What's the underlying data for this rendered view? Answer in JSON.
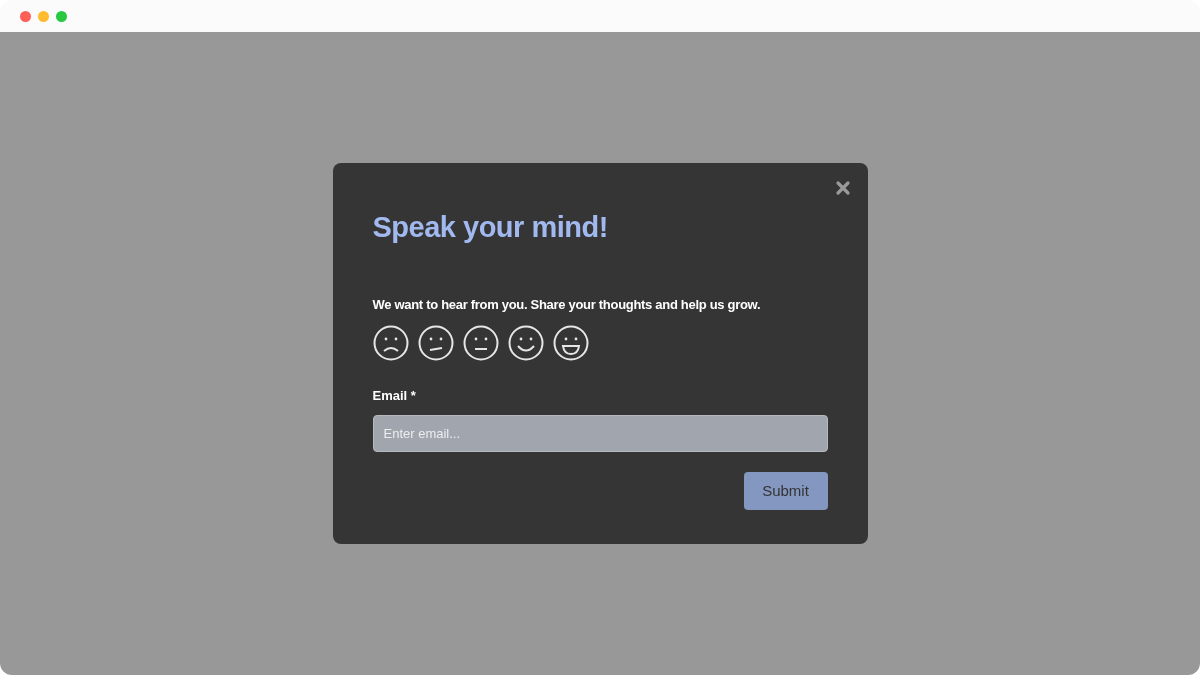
{
  "dialog": {
    "title": "Speak your mind!",
    "prompt": "We want to hear from you. Share your thoughts and help us grow.",
    "ratings": [
      {
        "kind": "sad",
        "selected": false
      },
      {
        "kind": "unsure",
        "selected": false
      },
      {
        "kind": "neutral",
        "selected": false
      },
      {
        "kind": "happy",
        "selected": false
      },
      {
        "kind": "delighted",
        "selected": false
      }
    ],
    "email": {
      "label": "Email *",
      "placeholder": "Enter email..."
    },
    "submit": "Submit"
  }
}
